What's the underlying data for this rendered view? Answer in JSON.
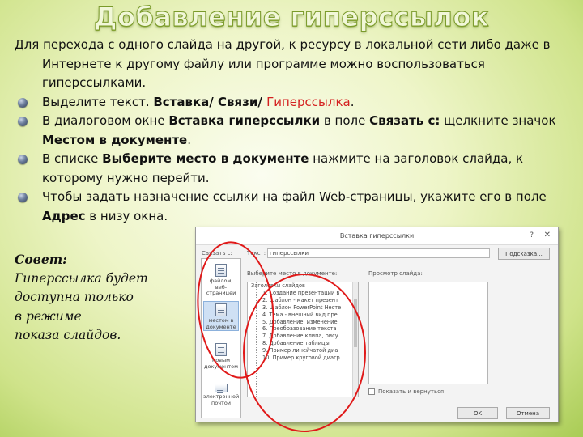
{
  "title": "Добавление гиперссылок",
  "intro": "Для перехода с одного слайда на другой, к ресурсу в локальной сети либо даже  в Интернете к другому файлу или программе можно воспользоваться гиперссылками.",
  "bullets": [
    {
      "before": "Выделите текст.  ",
      "bold": "Вставка/ Связи/ ",
      "red": "Гиперссылка",
      "after": "."
    },
    {
      "p1": "В диалоговом окне ",
      "b1": "Вставка гиперссылки",
      "p2": "  в поле ",
      "b2": "Связать с:",
      "p3": "  щелкните значок ",
      "b3": "Местом в документе",
      "p4": "."
    },
    {
      "p1": "В списке ",
      "b1": "Выберите место в документе",
      "p2": "  нажмите на заголовок слайда, к которому  нужно перейти."
    },
    {
      "p1": "Чтобы задать назначение ссылки на файл Web-страницы, укажите его в поле ",
      "b1": "Адрес",
      "p2": "  в низу окна."
    }
  ],
  "tip": {
    "title": "Совет:",
    "lines": [
      " Гиперссылка будет",
      "доступна  только",
      "в режиме",
      "показа слайдов."
    ]
  },
  "dialog": {
    "title": "Вставка гиперссылки",
    "help": "?",
    "close": "✕",
    "link_label": "Связать с:",
    "text_label": "Текст:",
    "text_value": "гиперссылки",
    "tip_button": "Подсказка...",
    "place_label": "Выберите место в документе:",
    "preview_label": "Просмотр слайда:",
    "show_return": "Показать и вернуться",
    "ok": "OK",
    "cancel": "Отмена",
    "link_items": [
      {
        "label": "файлом, веб-страницей",
        "icon": "file-icon"
      },
      {
        "label": "местом в документе",
        "icon": "document-place-icon"
      },
      {
        "label": "новым документом",
        "icon": "new-document-icon"
      },
      {
        "label": "электронной почтой",
        "icon": "email-icon"
      }
    ],
    "tree_root": "Заголовки слайдов",
    "tree_items": [
      "1. Создание презентации в",
      "2. Шаблон - макет презент",
      "3. Шаблон PowerPoint Несте",
      "4. Тема - внешний вид пре",
      "5. Добавление, изменение",
      "6. Преобразование текста",
      "7. Добавление клипа, рису",
      "8. Добавление таблицы",
      "9. Пример линейчатой диа",
      "10. Пример круговой диагр"
    ]
  },
  "colors": {
    "accent_red": "#d42020",
    "circle_red": "#e01919",
    "background_green": "#cfe38a"
  }
}
